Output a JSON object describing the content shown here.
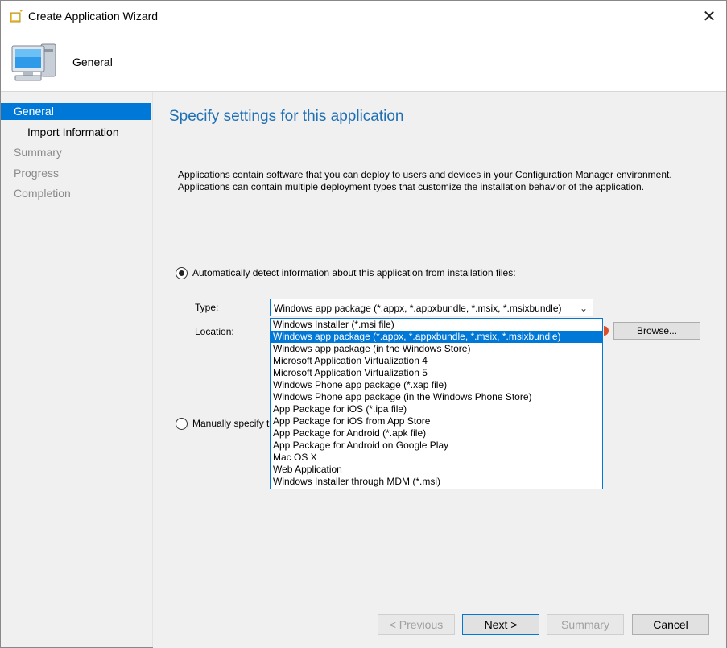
{
  "window": {
    "title": "Create Application Wizard",
    "close_glyph": "✕"
  },
  "header": {
    "title": "General",
    "icon": "computer-icon"
  },
  "sidebar": {
    "items": [
      {
        "label": "General",
        "state": "active"
      },
      {
        "label": "Import Information",
        "state": "sub"
      },
      {
        "label": "Summary",
        "state": "inactive"
      },
      {
        "label": "Progress",
        "state": "inactive"
      },
      {
        "label": "Completion",
        "state": "inactive"
      }
    ]
  },
  "main": {
    "heading": "Specify settings for this application",
    "intro_line1": "Applications contain software that you can deploy to users and devices in your Configuration Manager environment.",
    "intro_line2": "Applications can contain multiple deployment types that customize the installation behavior of the application.",
    "auto_detect_label": "Automatically detect information about this application from installation files:",
    "auto_detect_checked": true,
    "type_label": "Type:",
    "location_label": "Location:",
    "type_selected": "Windows app package (*.appx, *.appxbundle, *.msix, *.msixbundle)",
    "type_options": [
      "Windows Installer (*.msi file)",
      "Windows app package (*.appx, *.appxbundle, *.msix, *.msixbundle)",
      "Windows app package (in the Windows Store)",
      "Microsoft Application Virtualization 4",
      "Microsoft Application Virtualization 5",
      "Windows Phone app package (*.xap file)",
      "Windows Phone app package (in the Windows Phone Store)",
      "App Package for iOS (*.ipa file)",
      "App Package for iOS from App Store",
      "App Package for Android (*.apk file)",
      "App Package for Android on Google Play",
      "Mac OS X",
      "Web Application",
      "Windows Installer through MDM (*.msi)"
    ],
    "type_selected_index": 1,
    "browse_label": "Browse...",
    "manual_label": "Manually specify t",
    "manual_checked": false
  },
  "footer": {
    "previous_label": "< Previous",
    "next_label": "Next >",
    "summary_label": "Summary",
    "cancel_label": "Cancel"
  },
  "colors": {
    "accent": "#0078d7",
    "heading": "#1f6fb5",
    "panel": "#f0f0f0"
  }
}
